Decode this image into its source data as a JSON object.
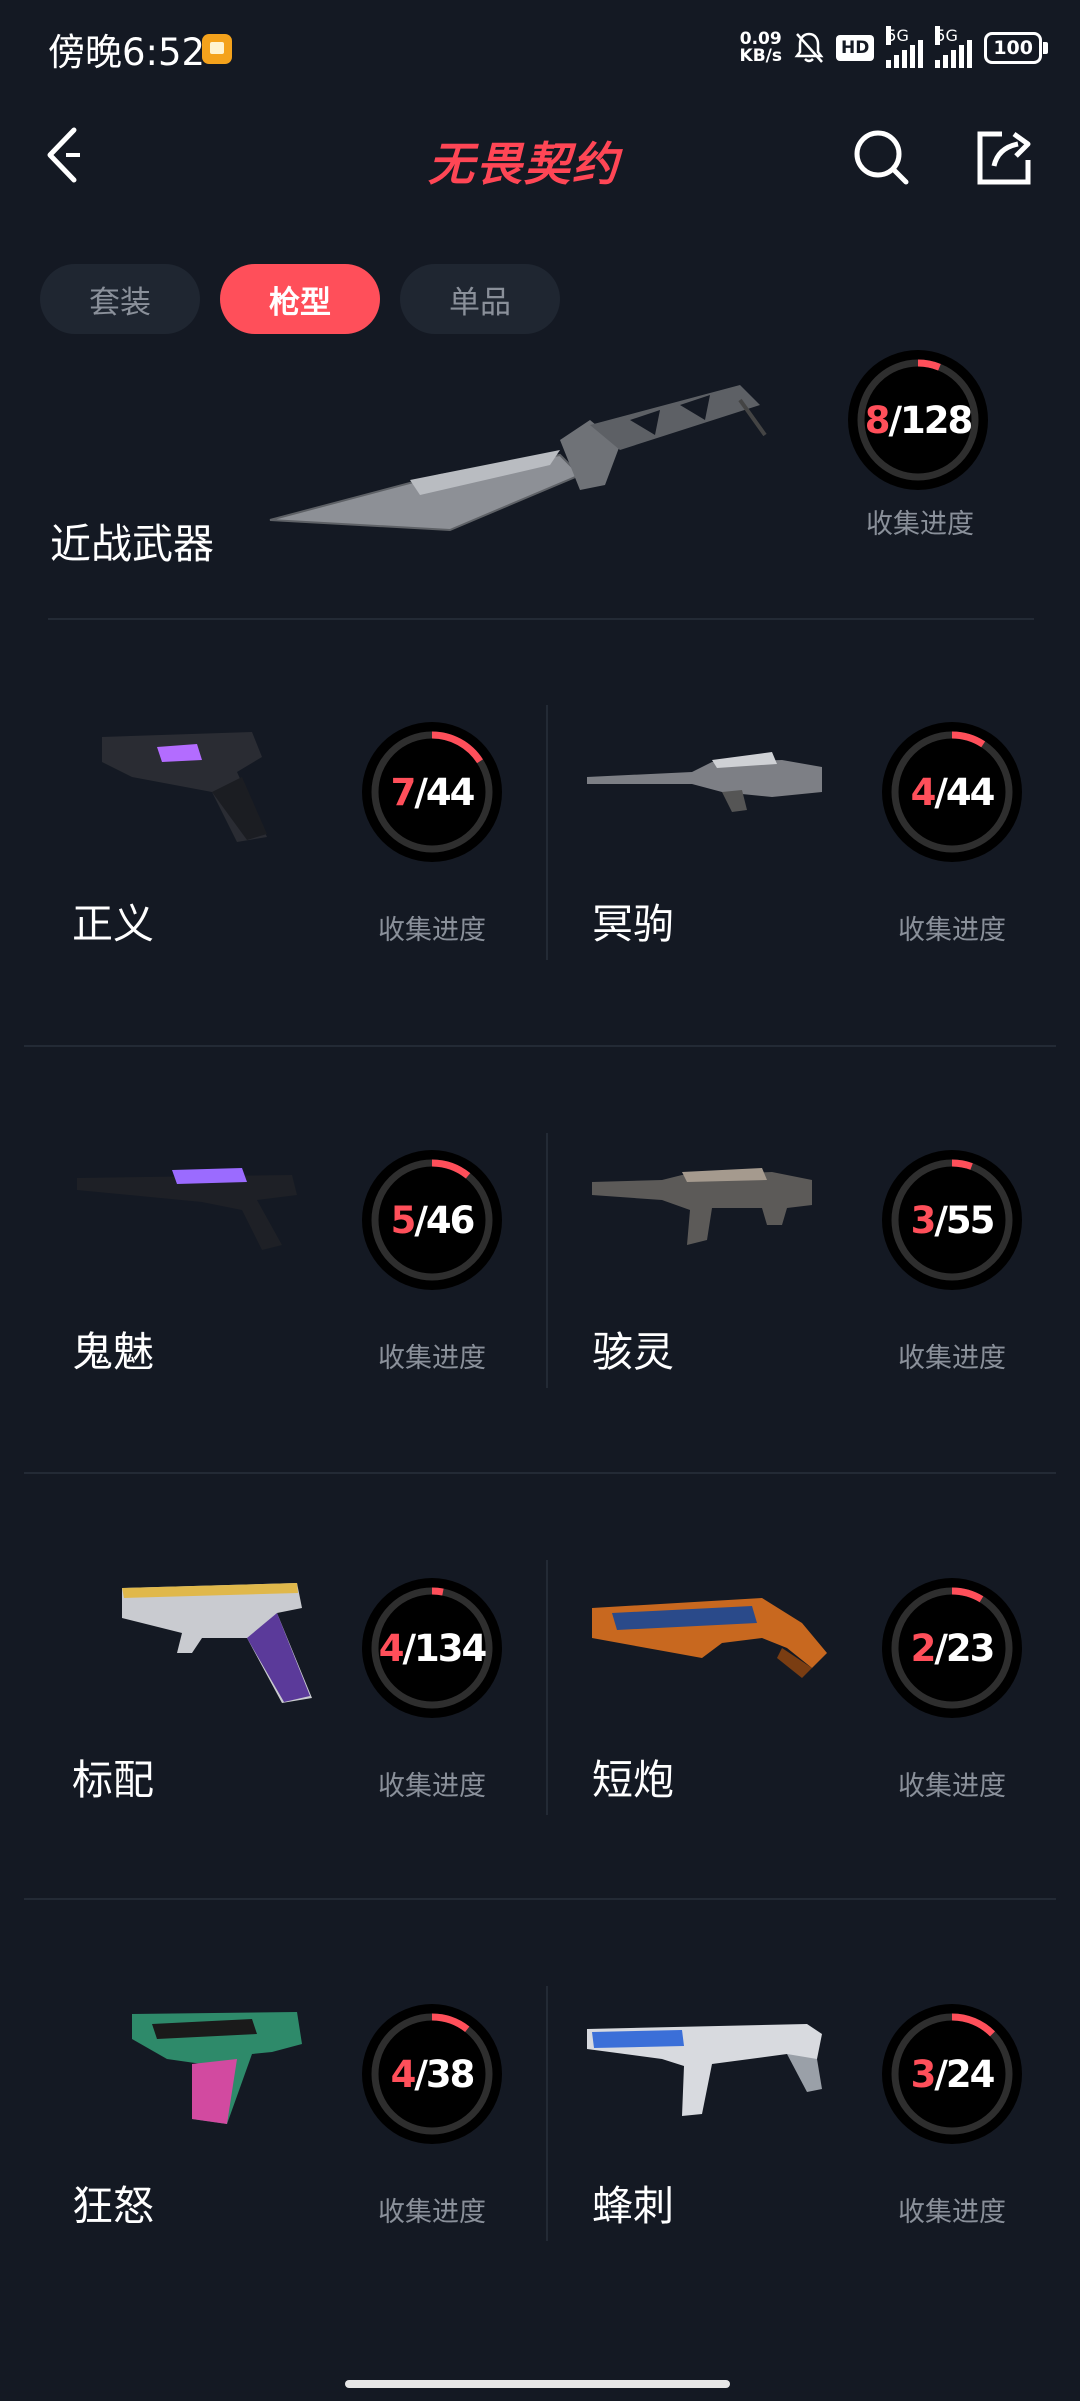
{
  "status_bar": {
    "time": "傍晚6:52",
    "net_speed_value": "0.09",
    "net_speed_unit": "KB/s",
    "hd_label": "HD",
    "sig1_label": "5G",
    "sig2_label": "5G",
    "battery": "100"
  },
  "nav": {
    "title": "无畏契约"
  },
  "tabs": [
    {
      "label": "套装"
    },
    {
      "label": "枪型"
    },
    {
      "label": "单品"
    }
  ],
  "progress_label": "收集进度",
  "featured": {
    "name": "近战武器",
    "current": "8",
    "sep": "/",
    "total": "128"
  },
  "weapons": [
    {
      "name": "正义",
      "current": "7",
      "sep": "/",
      "total": "44"
    },
    {
      "name": "冥驹",
      "current": "4",
      "sep": "/",
      "total": "44"
    },
    {
      "name": "鬼魅",
      "current": "5",
      "sep": "/",
      "total": "46"
    },
    {
      "name": "骇灵",
      "current": "3",
      "sep": "/",
      "total": "55"
    },
    {
      "name": "标配",
      "current": "4",
      "sep": "/",
      "total": "134"
    },
    {
      "name": "短炮",
      "current": "2",
      "sep": "/",
      "total": "23"
    },
    {
      "name": "狂怒",
      "current": "4",
      "sep": "/",
      "total": "38"
    },
    {
      "name": "蜂刺",
      "current": "3",
      "sep": "/",
      "total": "24"
    }
  ],
  "colors": {
    "accent": "#ff4f5a",
    "background": "#141923",
    "ring_track": "#2e2e2e"
  }
}
